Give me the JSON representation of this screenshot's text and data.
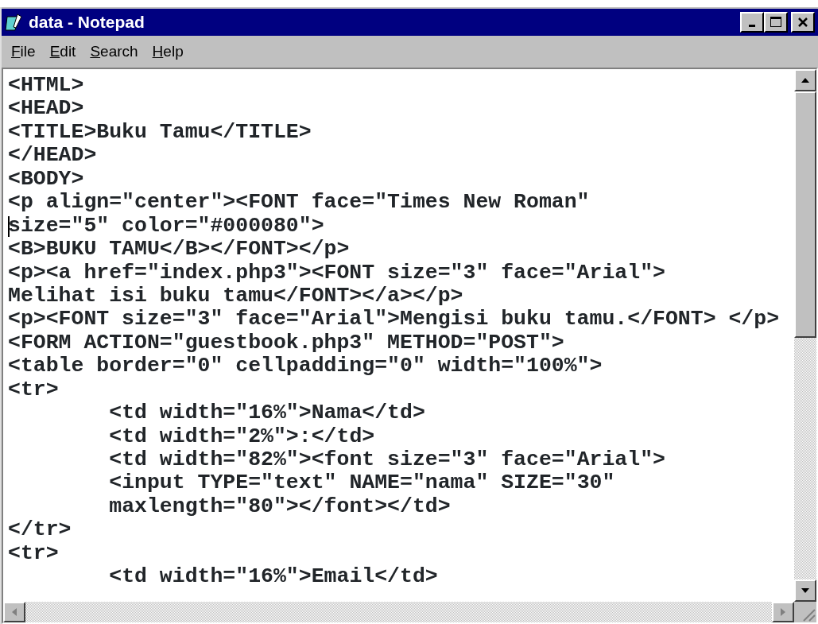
{
  "window": {
    "title": "data - Notepad"
  },
  "menu": [
    {
      "label": "File"
    },
    {
      "label": "Edit"
    },
    {
      "label": "Search"
    },
    {
      "label": "Help"
    }
  ],
  "lines": [
    {
      "text": "<HTML>",
      "caret": false
    },
    {
      "text": "<HEAD>",
      "caret": false
    },
    {
      "text": "<TITLE>Buku Tamu</TITLE>",
      "caret": false
    },
    {
      "text": "</HEAD>",
      "caret": false
    },
    {
      "text": "<BODY>",
      "caret": false
    },
    {
      "text": "<p align=\"center\"><FONT face=\"Times New Roman\"",
      "caret": false
    },
    {
      "text": "size=\"5\" color=\"#000080\">",
      "caret": true
    },
    {
      "text": "<B>BUKU TAMU</B></FONT></p>",
      "caret": false
    },
    {
      "text": "<p><a href=\"index.php3\"><FONT size=\"3\" face=\"Arial\">",
      "caret": false
    },
    {
      "text": "Melihat isi buku tamu</FONT></a></p>",
      "caret": false
    },
    {
      "text": "<p><FONT size=\"3\" face=\"Arial\">Mengisi buku tamu.</FONT> </p>",
      "caret": false
    },
    {
      "text": "<FORM ACTION=\"guestbook.php3\" METHOD=\"POST\">",
      "caret": false
    },
    {
      "text": "<table border=\"0\" cellpadding=\"0\" width=\"100%\">",
      "caret": false
    },
    {
      "text": "<tr>",
      "caret": false
    },
    {
      "text": "\t<td width=\"16%\">Nama</td>",
      "caret": false
    },
    {
      "text": "\t<td width=\"2%\">:</td>",
      "caret": false
    },
    {
      "text": "\t<td width=\"82%\"><font size=\"3\" face=\"Arial\">",
      "caret": false
    },
    {
      "text": "\t<input TYPE=\"text\" NAME=\"nama\" SIZE=\"30\"",
      "caret": false
    },
    {
      "text": "\tmaxlength=\"80\"></font></td>",
      "caret": false
    },
    {
      "text": "</tr>",
      "caret": false
    },
    {
      "text": "<tr>",
      "caret": false
    },
    {
      "text": "\t<td width=\"16%\">Email</td>",
      "caret": false
    }
  ]
}
